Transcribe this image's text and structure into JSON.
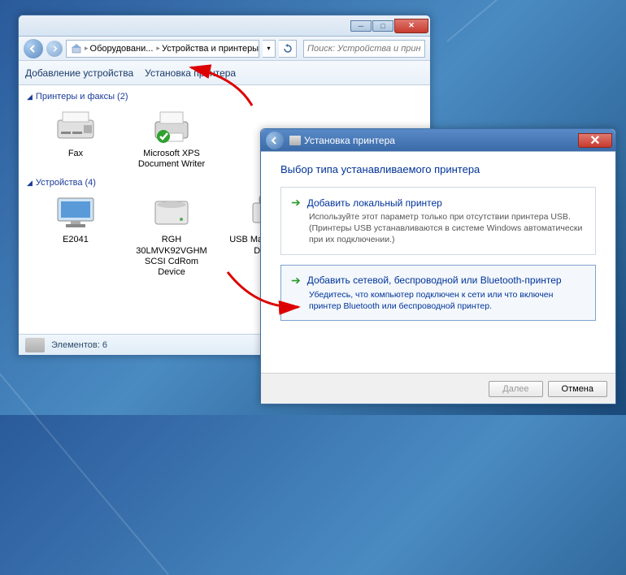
{
  "explorer": {
    "breadcrumb": {
      "seg1": "Оборудовани...",
      "seg2": "Устройства и принтеры"
    },
    "search_placeholder": "Поиск: Устройства и прин...",
    "toolbar": {
      "add_device": "Добавление устройства",
      "add_printer": "Установка принтера"
    },
    "sections": {
      "printers": {
        "title": "Принтеры и факсы (2)"
      },
      "devices": {
        "title": "Устройства (4)"
      }
    },
    "items": {
      "fax": "Fax",
      "xps": "Microsoft XPS Document Writer",
      "monitor": "E2041",
      "hdd": "RGH 30LMVK92VGHM SCSI CdRom Device",
      "usb": "USB Mass Storage Device"
    },
    "status": {
      "label": "Элементов: 6"
    }
  },
  "wizard": {
    "title": "Установка принтера",
    "heading": "Выбор типа устанавливаемого принтера",
    "options": [
      {
        "title": "Добавить локальный принтер",
        "desc": "Используйте этот параметр только при отсутствии принтера USB. (Принтеры USB устанавливаются в системе Windows автоматически при их подключении.)"
      },
      {
        "title": "Добавить сетевой, беспроводной или Bluetooth-принтер",
        "desc": "Убедитесь, что компьютер подключен к сети или что включен принтер Bluetooth или беспроводной принтер."
      }
    ],
    "buttons": {
      "next": "Далее",
      "cancel": "Отмена"
    }
  }
}
